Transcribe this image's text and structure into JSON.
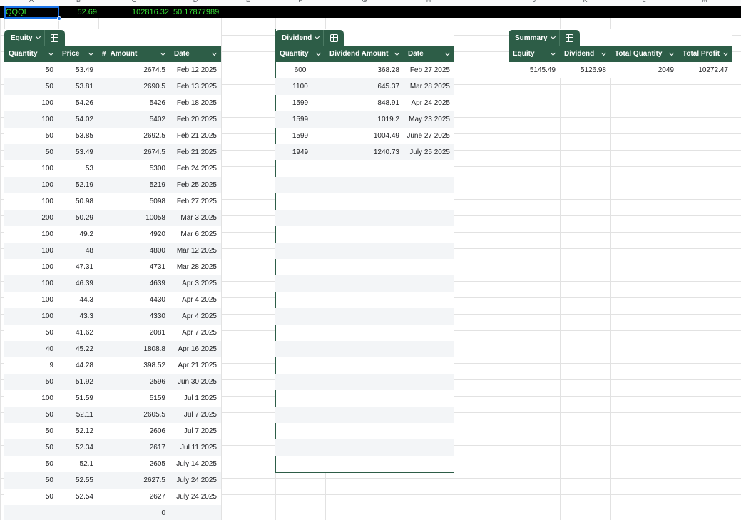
{
  "column_letters": [
    "A",
    "B",
    "C",
    "D",
    "E",
    "F",
    "G",
    "H",
    "I",
    "J",
    "K",
    "L",
    "M"
  ],
  "top_row": {
    "ticker": "QQQI",
    "price": "52.69",
    "total": "102816.32",
    "avg": "50.17877989"
  },
  "equity": {
    "tab_label": "Equity",
    "headers": [
      "Quantity",
      "Price",
      "Amount",
      "Date"
    ],
    "amount_type_symbol": "#",
    "rows": [
      [
        "50",
        "53.49",
        "2674.5",
        "Feb 12 2025"
      ],
      [
        "50",
        "53.81",
        "2690.5",
        "Feb 13 2025"
      ],
      [
        "100",
        "54.26",
        "5426",
        "Feb 18 2025"
      ],
      [
        "100",
        "54.02",
        "5402",
        "Feb 20 2025"
      ],
      [
        "50",
        "53.85",
        "2692.5",
        "Feb 21 2025"
      ],
      [
        "50",
        "53.49",
        "2674.5",
        "Feb 21 2025"
      ],
      [
        "100",
        "53",
        "5300",
        "Feb 24 2025"
      ],
      [
        "100",
        "52.19",
        "5219",
        "Feb 25 2025"
      ],
      [
        "100",
        "50.98",
        "5098",
        "Feb 27 2025"
      ],
      [
        "200",
        "50.29",
        "10058",
        "Mar 3 2025"
      ],
      [
        "100",
        "49.2",
        "4920",
        "Mar 6 2025"
      ],
      [
        "100",
        "48",
        "4800",
        "Mar 12 2025"
      ],
      [
        "100",
        "47.31",
        "4731",
        "Mar 28 2025"
      ],
      [
        "100",
        "46.39",
        "4639",
        "Apr 3 2025"
      ],
      [
        "100",
        "44.3",
        "4430",
        "Apr 4 2025"
      ],
      [
        "100",
        "43.3",
        "4330",
        "Apr 4 2025"
      ],
      [
        "50",
        "41.62",
        "2081",
        "Apr 7 2025"
      ],
      [
        "40",
        "45.22",
        "1808.8",
        "Apr 16 2025"
      ],
      [
        "9",
        "44.28",
        "398.52",
        "Apr 21 2025"
      ],
      [
        "50",
        "51.92",
        "2596",
        "Jun 30 2025"
      ],
      [
        "100",
        "51.59",
        "5159",
        "Jul 1 2025"
      ],
      [
        "50",
        "52.11",
        "2605.5",
        "Jul 7 2025"
      ],
      [
        "50",
        "52.12",
        "2606",
        "Jul 7 2025"
      ],
      [
        "50",
        "52.34",
        "2617",
        "Jul 11 2025"
      ],
      [
        "50",
        "52.1",
        "2605",
        "July 14 2025"
      ],
      [
        "50",
        "52.55",
        "2627.5",
        "July 24 2025"
      ],
      [
        "50",
        "52.54",
        "2627",
        "July 24 2025"
      ],
      [
        "",
        "",
        "0",
        ""
      ]
    ]
  },
  "dividend": {
    "tab_label": "Dividend",
    "headers": [
      "Quantity",
      "Dividend Amount",
      "Date"
    ],
    "rows": [
      [
        "600",
        "368.28",
        "Feb 27 2025"
      ],
      [
        "1100",
        "645.37",
        "Mar 28 2025"
      ],
      [
        "1599",
        "848.91",
        "Apr 24 2025"
      ],
      [
        "1599",
        "1019.2",
        "May 23 2025"
      ],
      [
        "1599",
        "1004.49",
        "June 27 2025"
      ],
      [
        "1949",
        "1240.73",
        "July 25 2025"
      ]
    ],
    "empty_rows": 19
  },
  "summary": {
    "tab_label": "Summary",
    "headers": [
      "Equity",
      "Dividend",
      "Total Quantity",
      "Total Profit"
    ],
    "rows": [
      [
        "5145.49",
        "5126.98",
        "2049",
        "10272.47"
      ]
    ]
  },
  "colors": {
    "header_green": "#2d5d47",
    "top_text_green": "#38e038",
    "selection_blue": "#1a73e8",
    "banded_row": "#f3f5f7"
  }
}
